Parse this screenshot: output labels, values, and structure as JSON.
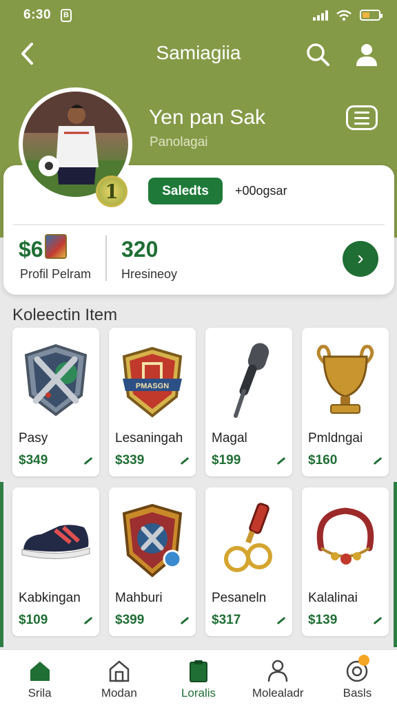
{
  "status_bar": {
    "time": "6:30",
    "left_icon": "B"
  },
  "nav": {
    "title": "Samiagiia"
  },
  "profile": {
    "name": "Yen pan Sak",
    "subtitle": "Panolagai",
    "rank": "1"
  },
  "card": {
    "select_label": "Saledts",
    "follow_text": "+00ogsar",
    "stat1_value": "$6",
    "stat1_label": "Profil Pelram",
    "stat2_value": "320",
    "stat2_label": "Hresineoy",
    "go_icon": "chevron-right-icon"
  },
  "section": {
    "title": "Koleectin Item"
  },
  "items": [
    {
      "name": "Pasy",
      "price": "$349",
      "icon": "shield-crossed-icon"
    },
    {
      "name": "Lesaningah",
      "price": "$339",
      "icon": "crest-badge-icon"
    },
    {
      "name": "Magal",
      "price": "$199",
      "icon": "microphone-icon"
    },
    {
      "name": "Pmldngai",
      "price": "$160",
      "icon": "trophy-cup-icon"
    },
    {
      "name": "Kabkingan",
      "price": "$109",
      "icon": "sneaker-icon"
    },
    {
      "name": "Mahburi",
      "price": "$399",
      "icon": "emblem-shield-icon"
    },
    {
      "name": "Pesaneln",
      "price": "$317",
      "icon": "whistle-rings-icon"
    },
    {
      "name": "Kalalinai",
      "price": "$139",
      "icon": "bracelet-icon"
    }
  ],
  "crest_text": "PMASGN",
  "bottom_nav": [
    {
      "label": "Srila",
      "icon": "home-icon",
      "active": false
    },
    {
      "label": "Modan",
      "icon": "building-icon",
      "active": false
    },
    {
      "label": "Loralis",
      "icon": "clipboard-icon",
      "active": true
    },
    {
      "label": "Molealadr",
      "icon": "person-icon",
      "active": false
    },
    {
      "label": "Basls",
      "icon": "target-icon",
      "active": false
    }
  ],
  "colors": {
    "hero": "#859a47",
    "primary_green": "#1f6e34",
    "button_green": "#1f7a3a",
    "badge_orange": "#f5a623"
  }
}
